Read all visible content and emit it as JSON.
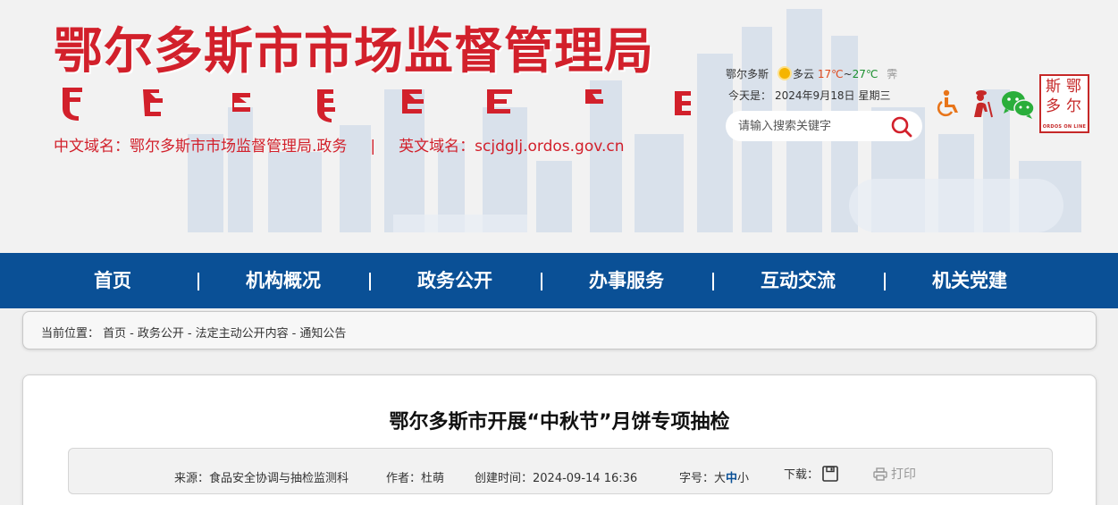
{
  "header": {
    "title": "鄂尔多斯市市场监督管理局",
    "cn_domain_label": "中文域名：",
    "cn_domain": "鄂尔多斯市市场监督管理局.政务",
    "separator": "|",
    "en_domain_label": "英文域名：",
    "en_domain": "scjdglj.ordos.gov.cn"
  },
  "weather": {
    "city": "鄂尔多斯",
    "condition": "多云",
    "low": "17℃",
    "tilde": "~",
    "high": "27℃",
    "trail": "霁",
    "icon": "sun-cloud-icon"
  },
  "date": {
    "prefix": "今天是：",
    "date": "2024年9月18日",
    "weekday": "星期三"
  },
  "search": {
    "placeholder": "请输入搜索关键字",
    "icon": "search-icon"
  },
  "logo": {
    "chars": [
      "鄂",
      "尔",
      "多",
      "斯"
    ],
    "en": "ORDOS ON LINE"
  },
  "nav": {
    "items": [
      {
        "label": "首页"
      },
      {
        "label": "机构概况"
      },
      {
        "label": "政务公开"
      },
      {
        "label": "办事服务"
      },
      {
        "label": "互动交流"
      },
      {
        "label": "机关党建"
      }
    ]
  },
  "breadcrumb": {
    "label": "当前位置：",
    "items": [
      "首页",
      "政务公开",
      "法定主动公开内容",
      "通知公告"
    ],
    "separator": "-"
  },
  "article": {
    "title": "鄂尔多斯市开展“中秋节”月饼专项抽检",
    "source_label": "来源：",
    "source": "食品安全协调与抽检监测科",
    "author_label": "作者：",
    "author": "杜萌",
    "created_label": "创建时间：",
    "created": "2024-09-14 16:36",
    "fontsize_label": "字号：",
    "fontsize_large": "大",
    "fontsize_medium": "中",
    "fontsize_small": "小",
    "download_label": "下载：",
    "print_label": "打印"
  },
  "colors": {
    "brand_red": "#d2202b",
    "nav_blue": "#0a5096"
  }
}
